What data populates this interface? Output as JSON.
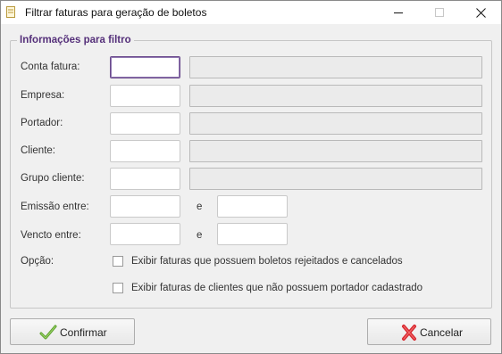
{
  "window": {
    "title": "Filtrar faturas para geração de boletos"
  },
  "group": {
    "legend": "Informações para filtro"
  },
  "fields": {
    "conta_fatura": {
      "label": "Conta fatura:",
      "code": "",
      "description": ""
    },
    "empresa": {
      "label": "Empresa:",
      "code": "",
      "description": ""
    },
    "portador": {
      "label": "Portador:",
      "code": "",
      "description": ""
    },
    "cliente": {
      "label": "Cliente:",
      "code": "",
      "description": ""
    },
    "grupo_cliente": {
      "label": "Grupo cliente:",
      "code": "",
      "description": ""
    },
    "emissao": {
      "label": "Emissão entre:",
      "from": "",
      "and_label": "e",
      "to": ""
    },
    "vencto": {
      "label": "Vencto entre:",
      "from": "",
      "and_label": "e",
      "to": ""
    }
  },
  "options": {
    "label": "Opção:",
    "items": [
      {
        "label": "Exibir faturas que possuem boletos rejeitados e cancelados",
        "checked": false
      },
      {
        "label": "Exibir faturas de clientes que não possuem portador cadastrado",
        "checked": false
      }
    ]
  },
  "buttons": {
    "confirm": {
      "label": "Confirmar",
      "icon": "check-icon",
      "color": "#5aa02c"
    },
    "cancel": {
      "label": "Cancelar",
      "icon": "x-icon",
      "color": "#d8262e"
    }
  }
}
